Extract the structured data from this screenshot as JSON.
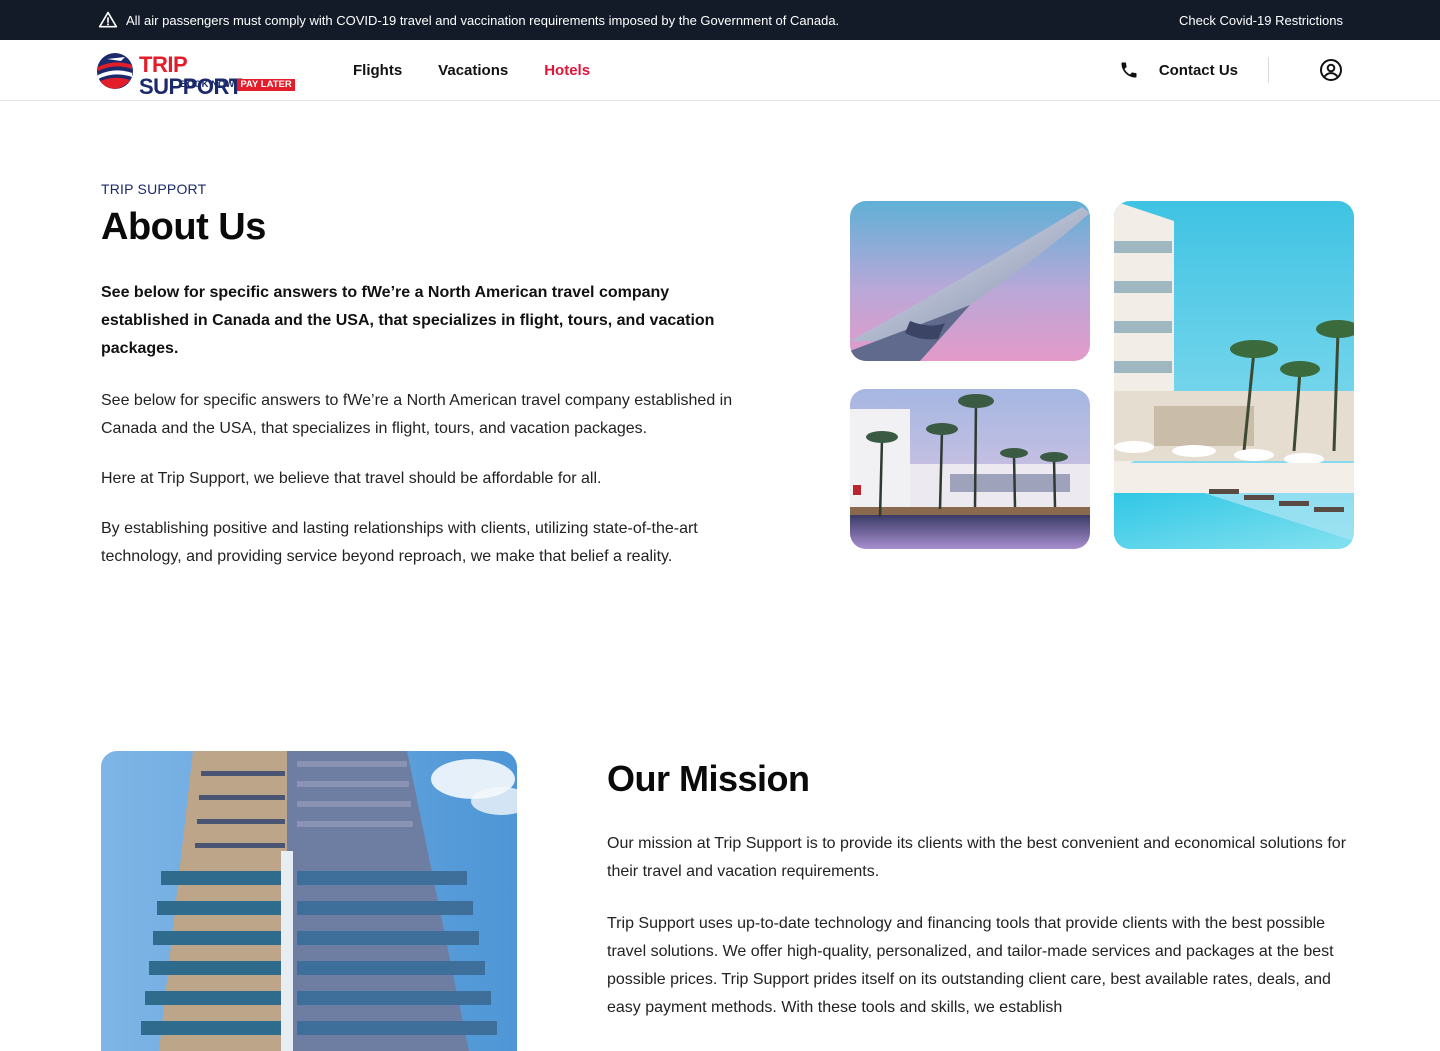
{
  "banner": {
    "message": "All air passengers must comply with COVID-19 travel and vaccination requirements imposed by the Government of Canada.",
    "link": "Check Covid-19 Restrictions"
  },
  "logo": {
    "brand_trip": "TRIP",
    "brand_support": "SUPPORT",
    "tag_book": "BOOK NOW",
    "tag_pay": "PAY LATER"
  },
  "nav": {
    "items": [
      {
        "label": "Flights",
        "active": false
      },
      {
        "label": "Vacations",
        "active": false
      },
      {
        "label": "Hotels",
        "active": true
      }
    ],
    "contact": "Contact Us",
    "icons": [
      "phone-icon",
      "user-icon"
    ]
  },
  "about": {
    "eyebrow": "TRIP SUPPORT",
    "title": "About Us",
    "lead": "See below for specific answers to fWe’re a North American travel company established in Canada and the USA, that specializes in flight, tours, and vacation packages.",
    "paragraphs": [
      "See below for specific answers to fWe’re a North American travel company established in Canada and the USA, that specializes in flight, tours, and vacation packages.",
      "Here at Trip Support, we believe that travel should be affordable for all.",
      "By establishing positive and lasting relationships with clients, utilizing state-of-the-art technology, and providing service beyond reproach, we make that belief a reality."
    ],
    "images": [
      "airplane-wing-photo",
      "hotel-pool-palms-photo",
      "resort-building-pool-photo"
    ]
  },
  "mission": {
    "title": "Our Mission",
    "paragraphs": [
      "Our mission at Trip Support is to provide its clients with the best convenient and economical solutions for their travel and vacation requirements.",
      "Trip Support uses up-to-date technology and financing tools that provide clients with the best possible travel solutions. We offer high-quality, personalized, and tailor-made services and packages at the best possible prices. Trip Support prides itself on its outstanding client care, best available rates, deals, and easy payment methods. With these tools and skills, we establish"
    ],
    "image": "office-tower-photo"
  },
  "colors": {
    "banner_bg": "#131b29",
    "active_nav": "#e0153a",
    "brand_red": "#e31e2a",
    "brand_navy": "#1b2a6b"
  }
}
